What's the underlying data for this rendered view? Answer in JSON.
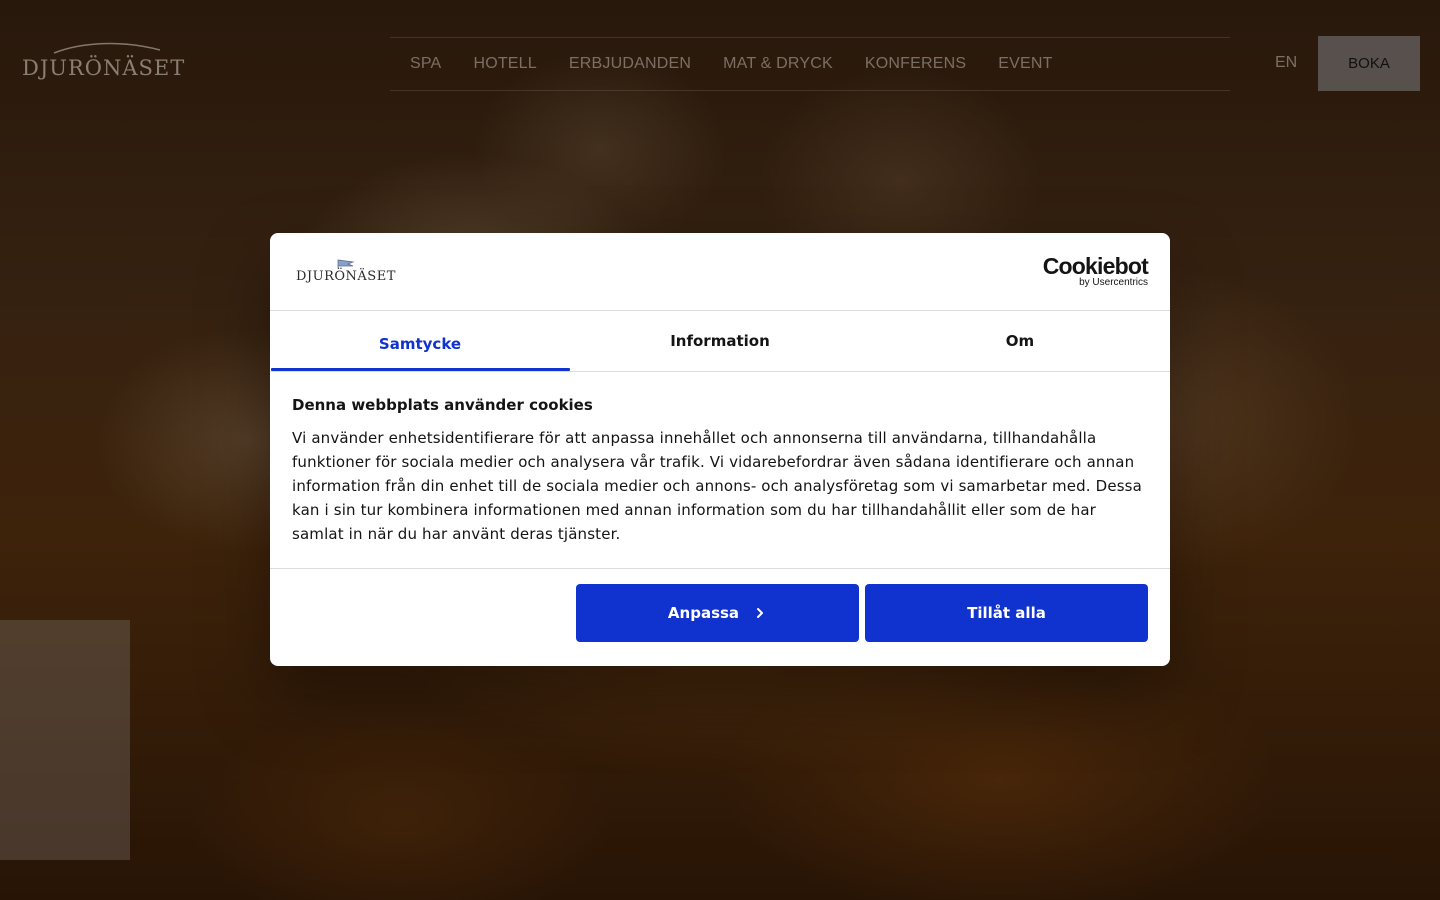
{
  "header": {
    "logo_text": "DJURÖNÄSET",
    "nav": [
      "SPA",
      "HOTELL",
      "ERBJUDANDEN",
      "MAT & DRYCK",
      "KONFERENS",
      "EVENT"
    ],
    "lang": "EN",
    "book_label": "BOKA"
  },
  "cookie_dialog": {
    "logo_text": "DJURÖNÄSET",
    "provider_logo": "Cookiebot",
    "provider_sub": "by Usercentrics",
    "tabs": [
      {
        "label": "Samtycke",
        "active": true
      },
      {
        "label": "Information",
        "active": false
      },
      {
        "label": "Om",
        "active": false
      }
    ],
    "title": "Denna webbplats använder cookies",
    "text": "Vi använder enhetsidentifierare för att anpassa innehållet och annonserna till användarna, tillhandahålla funktioner för sociala medier och analysera vår trafik. Vi vidarebefordrar även sådana identifierare och annan information från din enhet till de sociala medier och annons- och analysföretag som vi samarbetar med. Dessa kan i sin tur kombinera informationen med annan information som du har tillhandahållit eller som de har samlat in när du har använt deras tjänster.",
    "customize_label": "Anpassa",
    "allow_all_label": "Tillåt alla"
  },
  "colors": {
    "accent": "#1032cf",
    "book_button": "#5f5a58"
  }
}
